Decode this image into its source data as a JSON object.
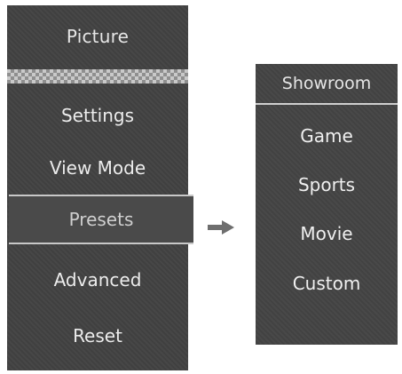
{
  "left_menu": {
    "title": "Picture",
    "items": [
      {
        "label": "Settings"
      },
      {
        "label": "View Mode"
      },
      {
        "label": "Presets",
        "selected": true
      },
      {
        "label": "Advanced"
      },
      {
        "label": "Reset"
      }
    ]
  },
  "arrow_icon": "arrow-right-icon",
  "submenu": {
    "title": "Showroom",
    "items": [
      {
        "label": "Game"
      },
      {
        "label": "Sports"
      },
      {
        "label": "Movie"
      },
      {
        "label": "Custom"
      }
    ]
  },
  "colors": {
    "panel_bg": "#404040",
    "text": "#ececec",
    "selection_border": "#c8c8c8",
    "arrow": "#6e6e6e"
  }
}
